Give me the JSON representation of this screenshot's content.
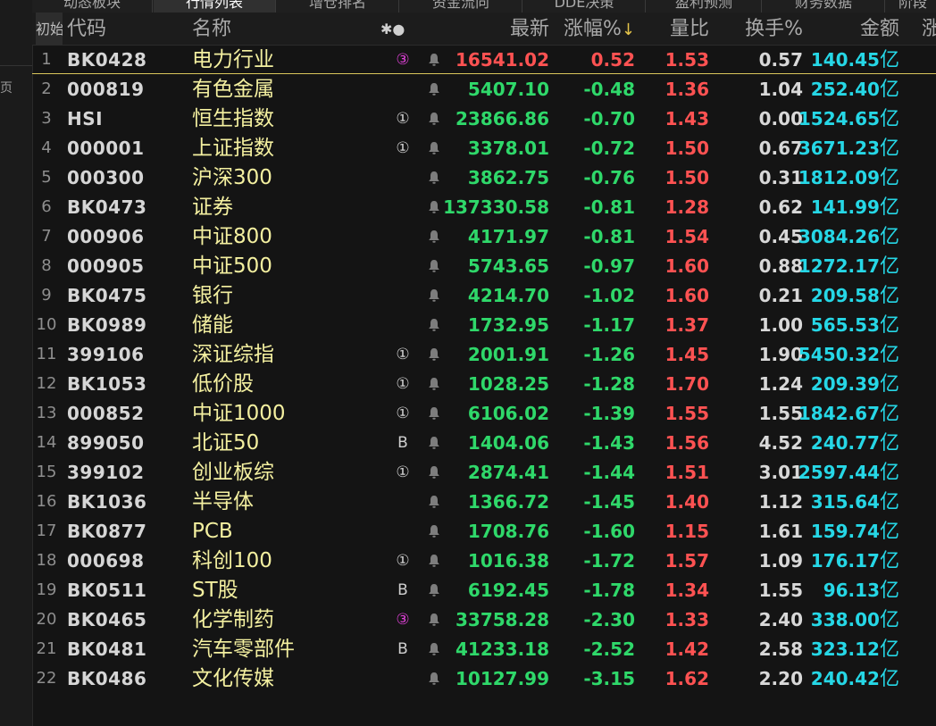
{
  "sidebar": {
    "side_char": "页"
  },
  "tabs": [
    {
      "label": "动态板块"
    },
    {
      "label": "行情列表"
    },
    {
      "label": "增仓排名"
    },
    {
      "label": "资金流向"
    },
    {
      "label": "DDE决策"
    },
    {
      "label": "盈利预测"
    },
    {
      "label": "财务数据"
    },
    {
      "label": "阶段"
    }
  ],
  "header": {
    "first": "初始",
    "code": "代码",
    "name": "名称",
    "flag": "✱●",
    "price": "最新",
    "change": "涨幅%",
    "sort_arrow": "↓",
    "volume_ratio": "量比",
    "turnover": "换手%",
    "amount": "金额",
    "extra": "涨"
  },
  "rows": [
    {
      "idx": "1",
      "code": "BK0428",
      "name": "电力行业",
      "flag": "③",
      "price": "16541.02",
      "change": "0.52",
      "vr": "1.53",
      "turn": "0.57",
      "amount": "140.45",
      "unit": "亿"
    },
    {
      "idx": "2",
      "code": "000819",
      "name": "有色金属",
      "flag": "",
      "price": "5407.10",
      "change": "-0.48",
      "vr": "1.36",
      "turn": "1.04",
      "amount": "252.40",
      "unit": "亿"
    },
    {
      "idx": "3",
      "code": "HSI",
      "name": "恒生指数",
      "flag": "①",
      "price": "23866.86",
      "change": "-0.70",
      "vr": "1.43",
      "turn": "0.00",
      "amount": "1524.65",
      "unit": "亿"
    },
    {
      "idx": "4",
      "code": "000001",
      "name": "上证指数",
      "flag": "①",
      "price": "3378.01",
      "change": "-0.72",
      "vr": "1.50",
      "turn": "0.67",
      "amount": "3671.23",
      "unit": "亿"
    },
    {
      "idx": "5",
      "code": "000300",
      "name": "沪深300",
      "flag": "",
      "price": "3862.75",
      "change": "-0.76",
      "vr": "1.50",
      "turn": "0.31",
      "amount": "1812.09",
      "unit": "亿"
    },
    {
      "idx": "6",
      "code": "BK0473",
      "name": "证券",
      "flag": "",
      "price": "137330.58",
      "change": "-0.81",
      "vr": "1.28",
      "turn": "0.62",
      "amount": "141.99",
      "unit": "亿"
    },
    {
      "idx": "7",
      "code": "000906",
      "name": "中证800",
      "flag": "",
      "price": "4171.97",
      "change": "-0.81",
      "vr": "1.54",
      "turn": "0.45",
      "amount": "3084.26",
      "unit": "亿"
    },
    {
      "idx": "8",
      "code": "000905",
      "name": "中证500",
      "flag": "",
      "price": "5743.65",
      "change": "-0.97",
      "vr": "1.60",
      "turn": "0.88",
      "amount": "1272.17",
      "unit": "亿"
    },
    {
      "idx": "9",
      "code": "BK0475",
      "name": "银行",
      "flag": "",
      "price": "4214.70",
      "change": "-1.02",
      "vr": "1.60",
      "turn": "0.21",
      "amount": "209.58",
      "unit": "亿"
    },
    {
      "idx": "10",
      "code": "BK0989",
      "name": "储能",
      "flag": "",
      "price": "1732.95",
      "change": "-1.17",
      "vr": "1.37",
      "turn": "1.00",
      "amount": "565.53",
      "unit": "亿"
    },
    {
      "idx": "11",
      "code": "399106",
      "name": "深证综指",
      "flag": "①",
      "price": "2001.91",
      "change": "-1.26",
      "vr": "1.45",
      "turn": "1.90",
      "amount": "5450.32",
      "unit": "亿"
    },
    {
      "idx": "12",
      "code": "BK1053",
      "name": "低价股",
      "flag": "①",
      "price": "1028.25",
      "change": "-1.28",
      "vr": "1.70",
      "turn": "1.24",
      "amount": "209.39",
      "unit": "亿"
    },
    {
      "idx": "13",
      "code": "000852",
      "name": "中证1000",
      "flag": "①",
      "price": "6106.02",
      "change": "-1.39",
      "vr": "1.55",
      "turn": "1.55",
      "amount": "1842.67",
      "unit": "亿"
    },
    {
      "idx": "14",
      "code": "899050",
      "name": "北证50",
      "flag": "B",
      "price": "1404.06",
      "change": "-1.43",
      "vr": "1.56",
      "turn": "4.52",
      "amount": "240.77",
      "unit": "亿"
    },
    {
      "idx": "15",
      "code": "399102",
      "name": "创业板综",
      "flag": "①",
      "price": "2874.41",
      "change": "-1.44",
      "vr": "1.51",
      "turn": "3.01",
      "amount": "2597.44",
      "unit": "亿"
    },
    {
      "idx": "16",
      "code": "BK1036",
      "name": "半导体",
      "flag": "",
      "price": "1366.72",
      "change": "-1.45",
      "vr": "1.40",
      "turn": "1.12",
      "amount": "315.64",
      "unit": "亿"
    },
    {
      "idx": "17",
      "code": "BK0877",
      "name": "PCB",
      "flag": "",
      "price": "1708.76",
      "change": "-1.60",
      "vr": "1.15",
      "turn": "1.61",
      "amount": "159.74",
      "unit": "亿"
    },
    {
      "idx": "18",
      "code": "000698",
      "name": "科创100",
      "flag": "①",
      "price": "1016.38",
      "change": "-1.72",
      "vr": "1.57",
      "turn": "1.09",
      "amount": "176.17",
      "unit": "亿"
    },
    {
      "idx": "19",
      "code": "BK0511",
      "name": "ST股",
      "flag": "B",
      "price": "6192.45",
      "change": "-1.78",
      "vr": "1.34",
      "turn": "1.55",
      "amount": "96.13",
      "unit": "亿"
    },
    {
      "idx": "20",
      "code": "BK0465",
      "name": "化学制药",
      "flag": "③",
      "price": "33758.28",
      "change": "-2.30",
      "vr": "1.33",
      "turn": "2.40",
      "amount": "338.00",
      "unit": "亿"
    },
    {
      "idx": "21",
      "code": "BK0481",
      "name": "汽车零部件",
      "flag": "B",
      "price": "41233.18",
      "change": "-2.52",
      "vr": "1.42",
      "turn": "2.58",
      "amount": "323.12",
      "unit": "亿"
    },
    {
      "idx": "22",
      "code": "BK0486",
      "name": "文化传媒",
      "flag": "",
      "price": "10127.99",
      "change": "-3.15",
      "vr": "1.62",
      "turn": "2.20",
      "amount": "240.42",
      "unit": "亿"
    }
  ],
  "colors": {
    "up": "#ff5252",
    "down": "#2fd86a",
    "amount": "#26d7e6",
    "name": "#f4f0a0",
    "selected_line": "#d9c65b",
    "flag_magenta": "#e040d8"
  },
  "icons": {
    "row_action": "bell-icon"
  }
}
